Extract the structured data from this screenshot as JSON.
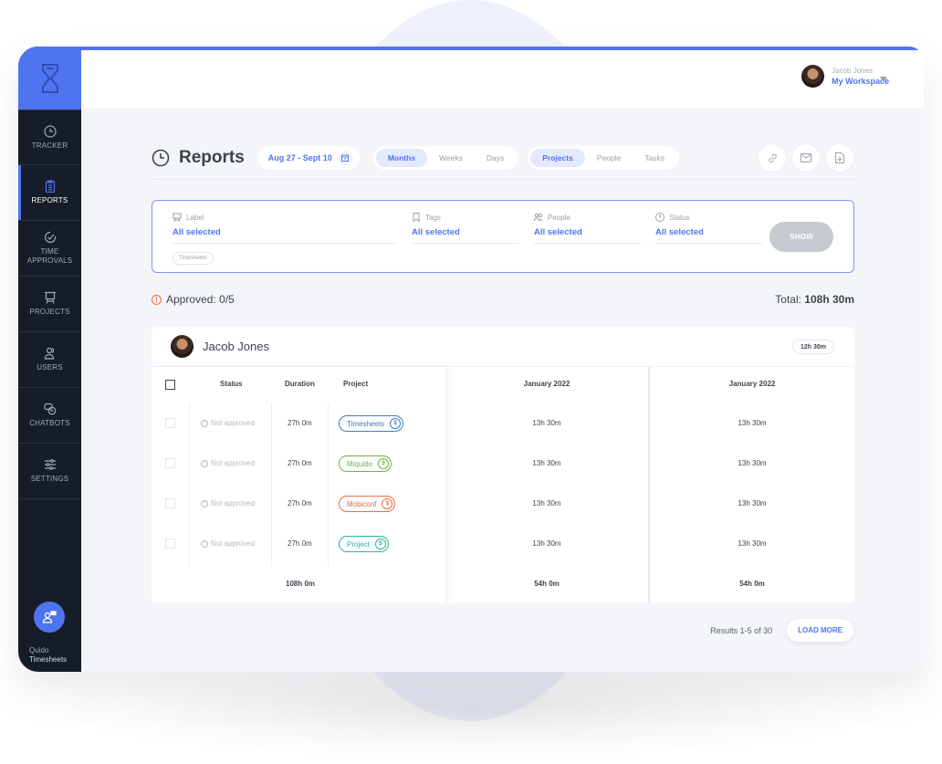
{
  "sidebar": {
    "logo": "hourglass-logo",
    "items": [
      {
        "label": "TRACKER",
        "icon": "clock-icon",
        "active": false
      },
      {
        "label": "REPORTS",
        "icon": "clipboard-icon",
        "active": true
      },
      {
        "label": "TIME APPROVALS",
        "icon": "check-circle-icon",
        "active": false
      },
      {
        "label": "PROJECTS",
        "icon": "easel-icon",
        "active": false
      },
      {
        "label": "USERS",
        "icon": "users-icon",
        "active": false
      },
      {
        "label": "CHATBOTS",
        "icon": "chat-bubbles-icon",
        "active": false
      },
      {
        "label": "SETTINGS",
        "icon": "sliders-icon",
        "active": false
      }
    ],
    "brand_line1": "Quido",
    "brand_line2": "Timesheets"
  },
  "header": {
    "user_name": "Jacob Jones",
    "workspace": "My Workspace"
  },
  "reports": {
    "title": "Reports",
    "date_range": "Aug 27 - Sept 10",
    "period_tabs": [
      {
        "label": "Months",
        "active": true
      },
      {
        "label": "Weeks",
        "active": false
      },
      {
        "label": "Days",
        "active": false
      }
    ],
    "group_tabs": [
      {
        "label": "Projects",
        "active": true
      },
      {
        "label": "People",
        "active": false
      },
      {
        "label": "Tasks",
        "active": false
      }
    ],
    "actions": [
      "link-icon",
      "mail-icon",
      "download-icon"
    ]
  },
  "filters": {
    "label": {
      "name": "Label",
      "value": "All selected"
    },
    "tags": {
      "name": "Tags",
      "value": "All selected"
    },
    "people": {
      "name": "People",
      "value": "All selected"
    },
    "status": {
      "name": "Status",
      "value": "All selected"
    },
    "chip": "Timesheets",
    "show_button": "SHOW"
  },
  "summary": {
    "approved": "Approved: 0/5",
    "total_label": "Total:",
    "total_value": "108h 30m"
  },
  "card": {
    "user_name": "Jacob Jones",
    "hours_badge": "12h 30m",
    "columns": {
      "status": "Status",
      "duration": "Duration",
      "project": "Project"
    },
    "rows": [
      {
        "status": "Not approved",
        "duration": "27h 0m",
        "project": "Timesheets",
        "color": "#3f7fc6",
        "months": [
          "13h 30m",
          "13h 30m"
        ]
      },
      {
        "status": "Not approved",
        "duration": "27h 0m",
        "project": "Miquido",
        "color": "#6fb83a",
        "months": [
          "13h 30m",
          "13h 30m"
        ]
      },
      {
        "status": "Not approved",
        "duration": "27h 0m",
        "project": "Mobiconf",
        "color": "#ef6e3d",
        "months": [
          "13h 30m",
          "13h 30m"
        ]
      },
      {
        "status": "Not approved",
        "duration": "27h 0m",
        "project": "Project",
        "color": "#2fb795",
        "months": [
          "13h 30m",
          "13h 30m"
        ]
      }
    ],
    "duration_total": "108h 0m",
    "month_columns": [
      {
        "label": "January 2022",
        "total": "54h 0m"
      },
      {
        "label": "January 2022",
        "total": "54h 0m"
      }
    ]
  },
  "pager": {
    "text": "Results 1-5 of 30",
    "load_more": "LOAD MORE"
  }
}
